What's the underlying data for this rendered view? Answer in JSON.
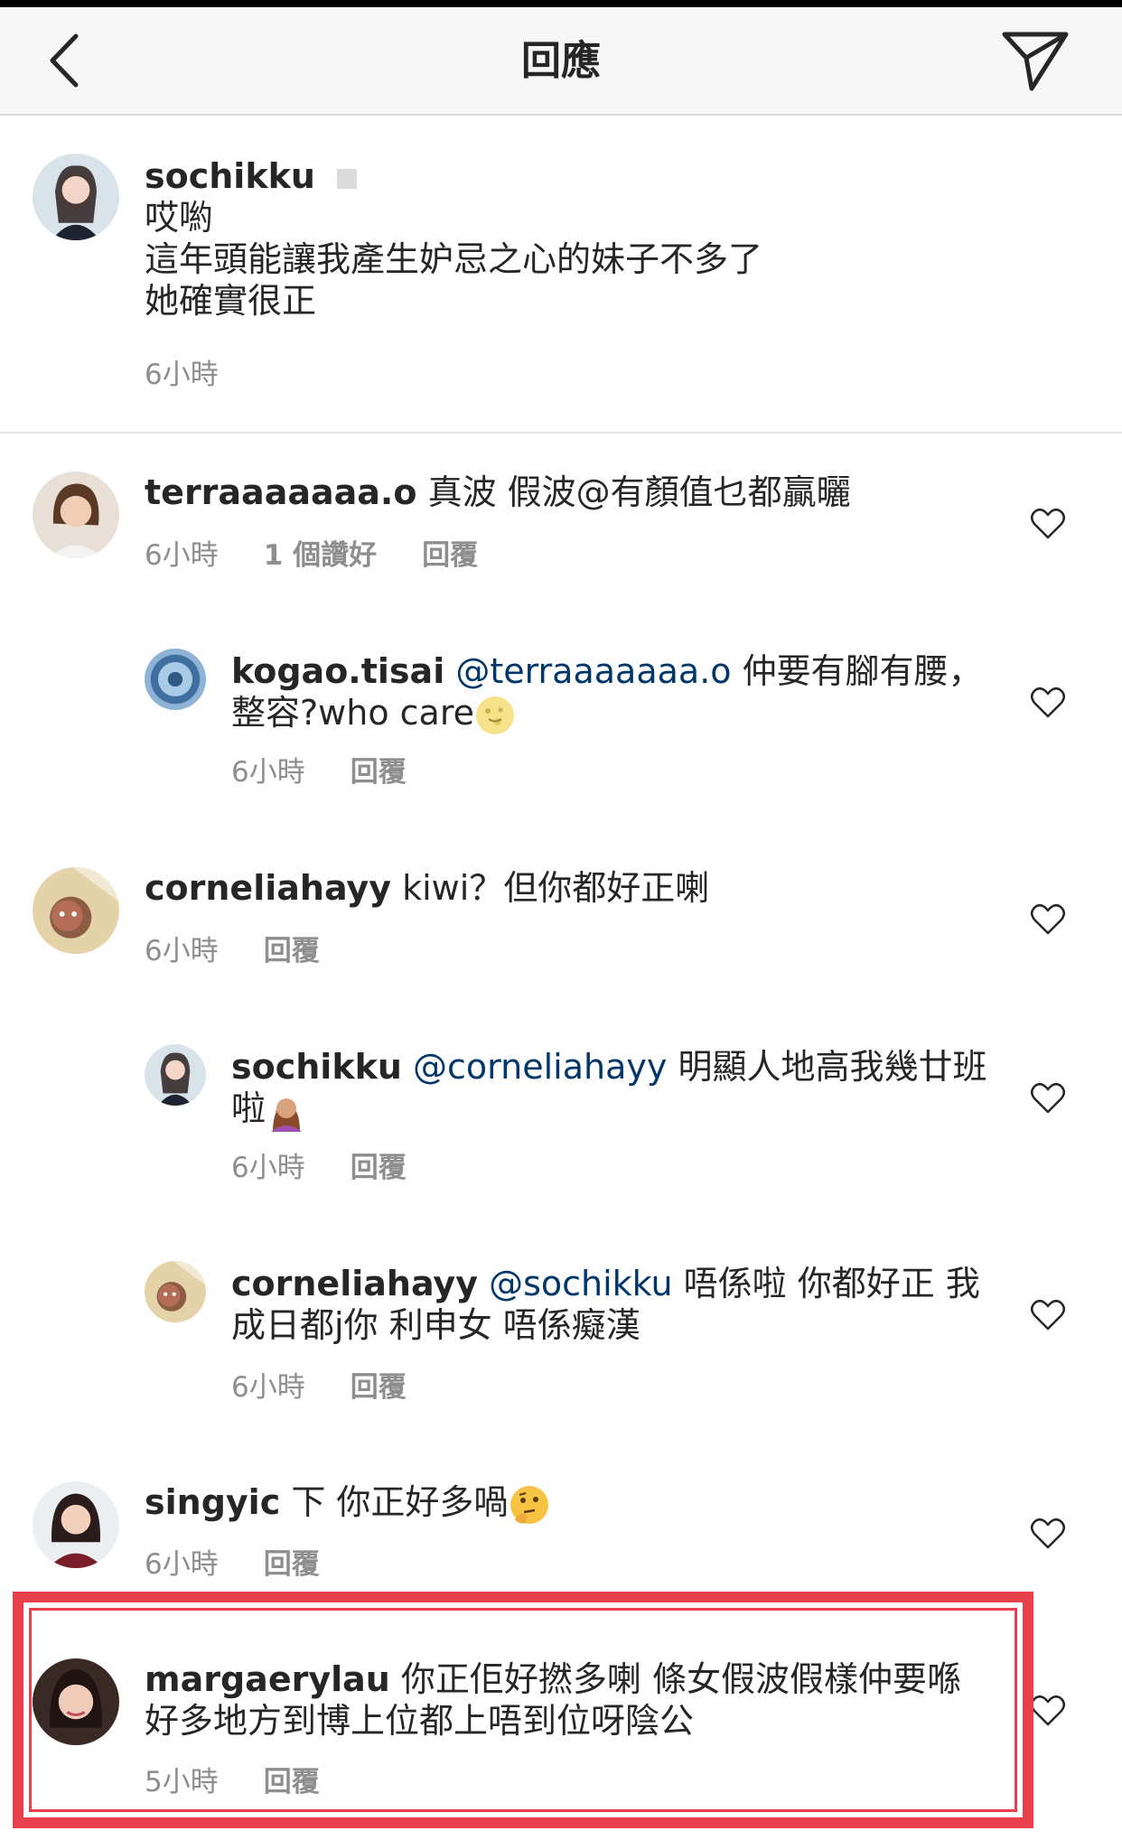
{
  "header": {
    "title": "回應"
  },
  "caption": {
    "username": "sochikku",
    "lines": [
      "哎喲",
      "這年頭能讓我產生妒忌之心的妹子不多了",
      "她確實很正"
    ],
    "time": "6小時"
  },
  "comments": [
    {
      "username": "terraaaaaaa.o",
      "text": "真波 假波@有顏值乜都贏曬",
      "time": "6小時",
      "likes": "1 個讚好",
      "reply": "回覆"
    },
    {
      "username": "kogao.tisai",
      "mention": "@terraaaaaaa.o",
      "text": "仲要有腳有腰，",
      "text2": "整容?who care",
      "time": "6小時",
      "reply": "回覆"
    },
    {
      "username": "corneliahayy",
      "text": "kiwi？但你都好正喇",
      "time": "6小時",
      "reply": "回覆"
    },
    {
      "username": "sochikku",
      "mention": "@corneliahayy",
      "text": "明顯人地高我幾廿班",
      "text2": "啦",
      "time": "6小時",
      "reply": "回覆"
    },
    {
      "username": "corneliahayy",
      "mention": "@sochikku",
      "text": "唔係啦 你都好正 我",
      "text2": "成日都j你 利申女 唔係癡漢",
      "time": "6小時",
      "reply": "回覆"
    },
    {
      "username": "singyic",
      "text": "下 你正好多喎",
      "time": "6小時",
      "reply": "回覆"
    },
    {
      "username": "margaerylau",
      "text": "你正佢好撚多喇 條女假波假樣仲要喺",
      "text2": "好多地方到博上位都上唔到位呀陰公",
      "time": "5小時",
      "reply": "回覆"
    }
  ],
  "colors": {
    "highlight": "#e8404b",
    "mention": "#00376b",
    "meta": "#8e8e8e"
  }
}
